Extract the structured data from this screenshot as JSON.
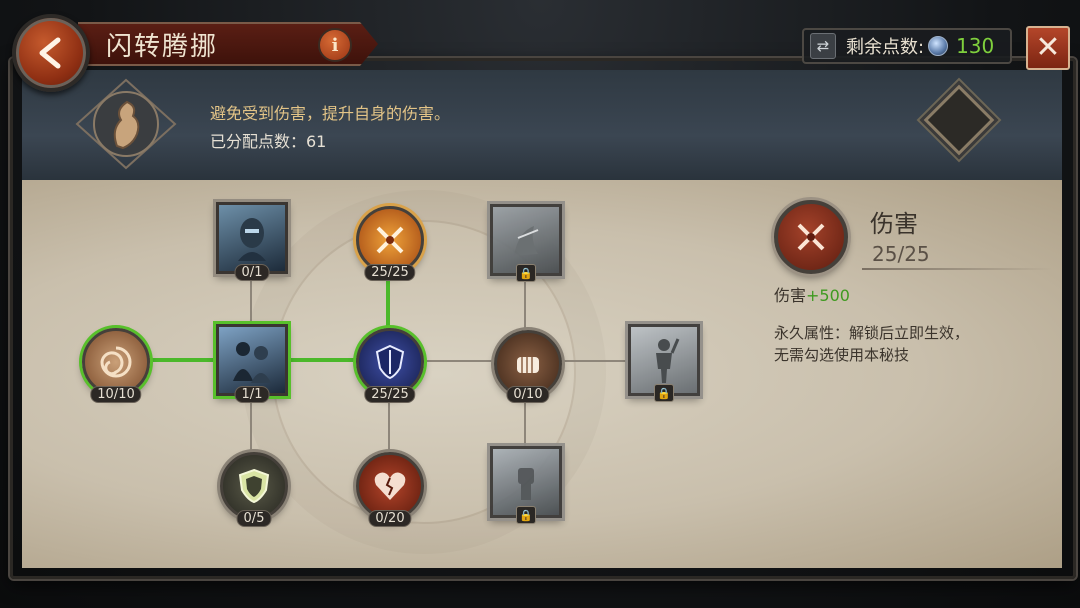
{
  "header": {
    "title": "闪转腾挪",
    "info_label": "i",
    "points_label": "剩余点数:",
    "points_value": "130",
    "close_label": "✕"
  },
  "ability": {
    "description": "避免受到伤害，提升自身的伤害。",
    "allocated_label": "已分配点数：61"
  },
  "nodes": [
    {
      "id": "n1",
      "level": "10/10",
      "icon": "swirl-icon"
    },
    {
      "id": "n2",
      "level": "0/1",
      "icon": "assassin-portrait-icon"
    },
    {
      "id": "n3",
      "level": "1/1",
      "icon": "dual-figures-icon"
    },
    {
      "id": "n4",
      "level": "0/5",
      "icon": "shield-icon"
    },
    {
      "id": "n5",
      "level": "25/25",
      "icon": "crossed-blades-icon"
    },
    {
      "id": "n6",
      "level": "25/25",
      "icon": "shield-crest-icon"
    },
    {
      "id": "n7",
      "level": "0/20",
      "icon": "broken-heart-icon"
    },
    {
      "id": "n8",
      "level": "",
      "icon": "shadow-figure-icon"
    },
    {
      "id": "n9",
      "level": "0/10",
      "icon": "fist-icon"
    },
    {
      "id": "n10",
      "level": "",
      "icon": "raised-fist-icon"
    },
    {
      "id": "n11",
      "level": "",
      "icon": "warrior-silhouette-icon"
    }
  ],
  "detail": {
    "name": "伤害",
    "level": "25/25",
    "bonus_label": "伤害",
    "bonus_value": "+500",
    "desc_line1": "永久属性：解锁后立即生效，",
    "desc_line2": "无需勾选使用本秘技"
  },
  "colors": {
    "active_link": "#4bb82a",
    "points_green": "#7fd03d",
    "accent_red": "#9a3515"
  }
}
